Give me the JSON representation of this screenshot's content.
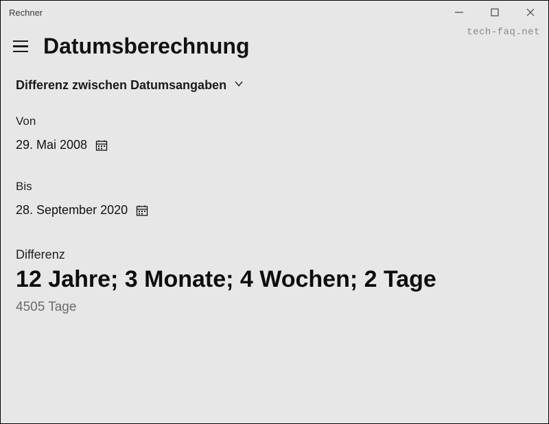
{
  "window": {
    "title": "Rechner"
  },
  "watermark": "tech-faq.net",
  "page": {
    "title": "Datumsberechnung"
  },
  "mode_dropdown": {
    "label": "Differenz zwischen Datumsangaben"
  },
  "from": {
    "label": "Von",
    "date": "29. Mai 2008"
  },
  "to": {
    "label": "Bis",
    "date": "28. September 2020"
  },
  "result": {
    "label": "Differenz",
    "main": "12 Jahre; 3 Monate; 4 Wochen; 2 Tage",
    "days": "4505 Tage"
  }
}
